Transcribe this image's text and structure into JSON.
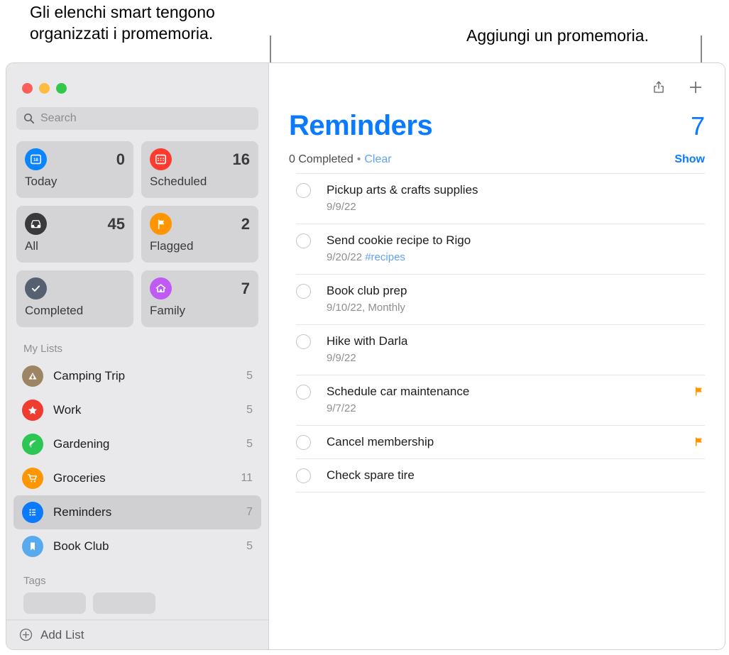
{
  "callouts": {
    "left": "Gli elenchi smart tengono\norganizzati i promemoria.",
    "right": "Aggiungi un promemoria."
  },
  "window": {
    "traffic_lights": [
      {
        "name": "close",
        "color": "#fc6058"
      },
      {
        "name": "minimize",
        "color": "#fdbc40"
      },
      {
        "name": "zoom",
        "color": "#34c749"
      }
    ]
  },
  "sidebar": {
    "search": {
      "placeholder": "Search"
    },
    "smart_lists": [
      {
        "label": "Today",
        "count": "0",
        "icon": "calendar-today-icon",
        "color": "#0a84ff"
      },
      {
        "label": "Scheduled",
        "count": "16",
        "icon": "calendar-icon",
        "color": "#ff3b30"
      },
      {
        "label": "All",
        "count": "45",
        "icon": "inbox-tray-icon",
        "color": "#3a3a3c"
      },
      {
        "label": "Flagged",
        "count": "2",
        "icon": "flag-icon",
        "color": "#ff9500"
      },
      {
        "label": "Completed",
        "count": "",
        "icon": "checkmark-icon",
        "color": "#556070"
      },
      {
        "label": "Family",
        "count": "7",
        "icon": "house-icon",
        "color": "#bf5af2"
      }
    ],
    "my_lists_header": "My Lists",
    "lists": [
      {
        "label": "Camping Trip",
        "count": "5",
        "icon": "tent-icon",
        "color": "#9d8462"
      },
      {
        "label": "Work",
        "count": "5",
        "icon": "star-icon",
        "color": "#ef3b30"
      },
      {
        "label": "Gardening",
        "count": "5",
        "icon": "leaf-icon",
        "color": "#2bc653"
      },
      {
        "label": "Groceries",
        "count": "11",
        "icon": "cart-icon",
        "color": "#ff9500"
      },
      {
        "label": "Reminders",
        "count": "7",
        "icon": "bullet-list-icon",
        "color": "#0a7aff",
        "selected": true
      },
      {
        "label": "Book Club",
        "count": "5",
        "icon": "bookmark-icon",
        "color": "#58aaef"
      }
    ],
    "tags_header": "Tags",
    "add_list_label": "Add List"
  },
  "main": {
    "toolbar": {
      "share_icon": "share-icon",
      "add_icon": "plus-icon"
    },
    "title": "Reminders",
    "count": "7",
    "completed_text": "0 Completed",
    "separator": "•",
    "clear_label": "Clear",
    "show_label": "Show",
    "reminders": [
      {
        "title": "Pickup arts & crafts supplies",
        "sub": "9/9/22",
        "tag": "",
        "flagged": false
      },
      {
        "title": "Send cookie recipe to Rigo",
        "sub": "9/20/22",
        "tag": "#recipes",
        "flagged": false
      },
      {
        "title": "Book club prep",
        "sub": "9/10/22, Monthly",
        "tag": "",
        "flagged": false
      },
      {
        "title": "Hike with Darla",
        "sub": "9/9/22",
        "tag": "",
        "flagged": false
      },
      {
        "title": "Schedule car maintenance",
        "sub": "9/7/22",
        "tag": "",
        "flagged": true
      },
      {
        "title": "Cancel membership",
        "sub": "",
        "tag": "",
        "flagged": true
      },
      {
        "title": "Check spare tire",
        "sub": "",
        "tag": "",
        "flagged": false
      }
    ]
  },
  "colors": {
    "accent_blue": "#0a7aff",
    "link_blue": "#5fa2f5",
    "flag_orange": "#ff9500",
    "sidebar_bg": "#e9e9eb"
  }
}
